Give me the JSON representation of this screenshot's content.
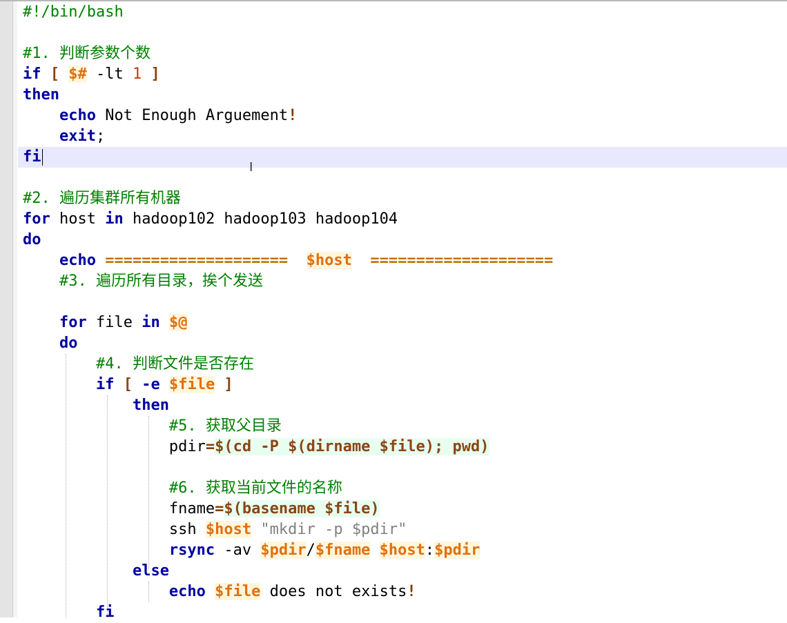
{
  "editor": {
    "language": "bash",
    "lines": [
      [
        {
          "t": "#!/bin/bash",
          "c": "cm"
        }
      ],
      [],
      [
        {
          "t": "#1. 判断参数个数",
          "c": "cm"
        }
      ],
      [
        {
          "t": "if",
          "c": "kw"
        },
        {
          "t": " ",
          "c": "plain"
        },
        {
          "t": "[",
          "c": "br"
        },
        {
          "t": " ",
          "c": "plain"
        },
        {
          "t": "$#",
          "c": "var"
        },
        {
          "t": " -lt ",
          "c": "plain"
        },
        {
          "t": "1",
          "c": "num"
        },
        {
          "t": " ",
          "c": "plain"
        },
        {
          "t": "]",
          "c": "br"
        }
      ],
      [
        {
          "t": "then",
          "c": "kw"
        }
      ],
      [
        {
          "t": "    ",
          "c": "plain"
        },
        {
          "t": "echo",
          "c": "kw"
        },
        {
          "t": " Not Enough Arguement",
          "c": "plain"
        },
        {
          "t": "!",
          "c": "op"
        }
      ],
      [
        {
          "t": "    ",
          "c": "plain"
        },
        {
          "t": "exit",
          "c": "kw"
        },
        {
          "t": ";",
          "c": "plain"
        }
      ],
      [
        {
          "t": "fi",
          "c": "kw"
        }
      ],
      [],
      [
        {
          "t": "#2. 遍历集群所有机器",
          "c": "cm"
        }
      ],
      [
        {
          "t": "for",
          "c": "kw"
        },
        {
          "t": " host ",
          "c": "plain"
        },
        {
          "t": "in",
          "c": "kw"
        },
        {
          "t": " hadoop102 hadoop103 hadoop104",
          "c": "plain"
        }
      ],
      [
        {
          "t": "do",
          "c": "kw"
        }
      ],
      [
        {
          "t": "    ",
          "c": "plain"
        },
        {
          "t": "echo",
          "c": "kw"
        },
        {
          "t": " ",
          "c": "plain"
        },
        {
          "t": "====================",
          "c": "sep"
        },
        {
          "t": "  ",
          "c": "plain"
        },
        {
          "t": "$host",
          "c": "var"
        },
        {
          "t": "  ",
          "c": "plain"
        },
        {
          "t": "====================",
          "c": "sep"
        }
      ],
      [
        {
          "t": "    ",
          "c": "plain"
        },
        {
          "t": "#3. 遍历所有目录，挨个发送",
          "c": "cm"
        }
      ],
      [],
      [
        {
          "t": "    ",
          "c": "plain"
        },
        {
          "t": "for",
          "c": "kw"
        },
        {
          "t": " file ",
          "c": "plain"
        },
        {
          "t": "in",
          "c": "kw"
        },
        {
          "t": " ",
          "c": "plain"
        },
        {
          "t": "$@",
          "c": "var"
        }
      ],
      [
        {
          "t": "    ",
          "c": "plain"
        },
        {
          "t": "do",
          "c": "kw"
        }
      ],
      [
        {
          "t": "        ",
          "c": "plain"
        },
        {
          "t": "#4. 判断文件是否存在",
          "c": "cm"
        }
      ],
      [
        {
          "t": "        ",
          "c": "plain"
        },
        {
          "t": "if",
          "c": "kw"
        },
        {
          "t": " ",
          "c": "plain"
        },
        {
          "t": "[",
          "c": "br"
        },
        {
          "t": " ",
          "c": "plain"
        },
        {
          "t": "-e",
          "c": "kw"
        },
        {
          "t": " ",
          "c": "plain"
        },
        {
          "t": "$file",
          "c": "var"
        },
        {
          "t": " ",
          "c": "plain"
        },
        {
          "t": "]",
          "c": "br"
        }
      ],
      [
        {
          "t": "            ",
          "c": "plain"
        },
        {
          "t": "then",
          "c": "kw"
        }
      ],
      [
        {
          "t": "                ",
          "c": "plain"
        },
        {
          "t": "#5. 获取父目录",
          "c": "cm"
        }
      ],
      [
        {
          "t": "                ",
          "c": "plain"
        },
        {
          "t": "pdir",
          "c": "plain"
        },
        {
          "t": "=",
          "c": "op"
        },
        {
          "t": "$(cd -P $(dirname $file); pwd)",
          "c": "sub"
        }
      ],
      [],
      [
        {
          "t": "                ",
          "c": "plain"
        },
        {
          "t": "#6. 获取当前文件的名称",
          "c": "cm"
        }
      ],
      [
        {
          "t": "                ",
          "c": "plain"
        },
        {
          "t": "fname",
          "c": "plain"
        },
        {
          "t": "=",
          "c": "op"
        },
        {
          "t": "$(basename $file)",
          "c": "sub"
        }
      ],
      [
        {
          "t": "                ",
          "c": "plain"
        },
        {
          "t": "ssh ",
          "c": "plain"
        },
        {
          "t": "$host",
          "c": "var"
        },
        {
          "t": " ",
          "c": "plain"
        },
        {
          "t": "\"mkdir -p $pdir\"",
          "c": "str"
        }
      ],
      [
        {
          "t": "                ",
          "c": "plain"
        },
        {
          "t": "rsync",
          "c": "kw"
        },
        {
          "t": " -av ",
          "c": "plain"
        },
        {
          "t": "$pdir",
          "c": "var"
        },
        {
          "t": "/",
          "c": "plain"
        },
        {
          "t": "$fname",
          "c": "var"
        },
        {
          "t": " ",
          "c": "plain"
        },
        {
          "t": "$host",
          "c": "var"
        },
        {
          "t": ":",
          "c": "plain"
        },
        {
          "t": "$pdir",
          "c": "var"
        }
      ],
      [
        {
          "t": "            ",
          "c": "plain"
        },
        {
          "t": "else",
          "c": "kw"
        }
      ],
      [
        {
          "t": "                ",
          "c": "plain"
        },
        {
          "t": "echo",
          "c": "kw"
        },
        {
          "t": " ",
          "c": "plain"
        },
        {
          "t": "$file",
          "c": "var"
        },
        {
          "t": " does not exists",
          "c": "plain"
        },
        {
          "t": "!",
          "c": "op"
        }
      ],
      [
        {
          "t": "        ",
          "c": "plain"
        },
        {
          "t": "fi",
          "c": "kw"
        }
      ]
    ],
    "caret_line": 7,
    "highlight_line": 7
  }
}
